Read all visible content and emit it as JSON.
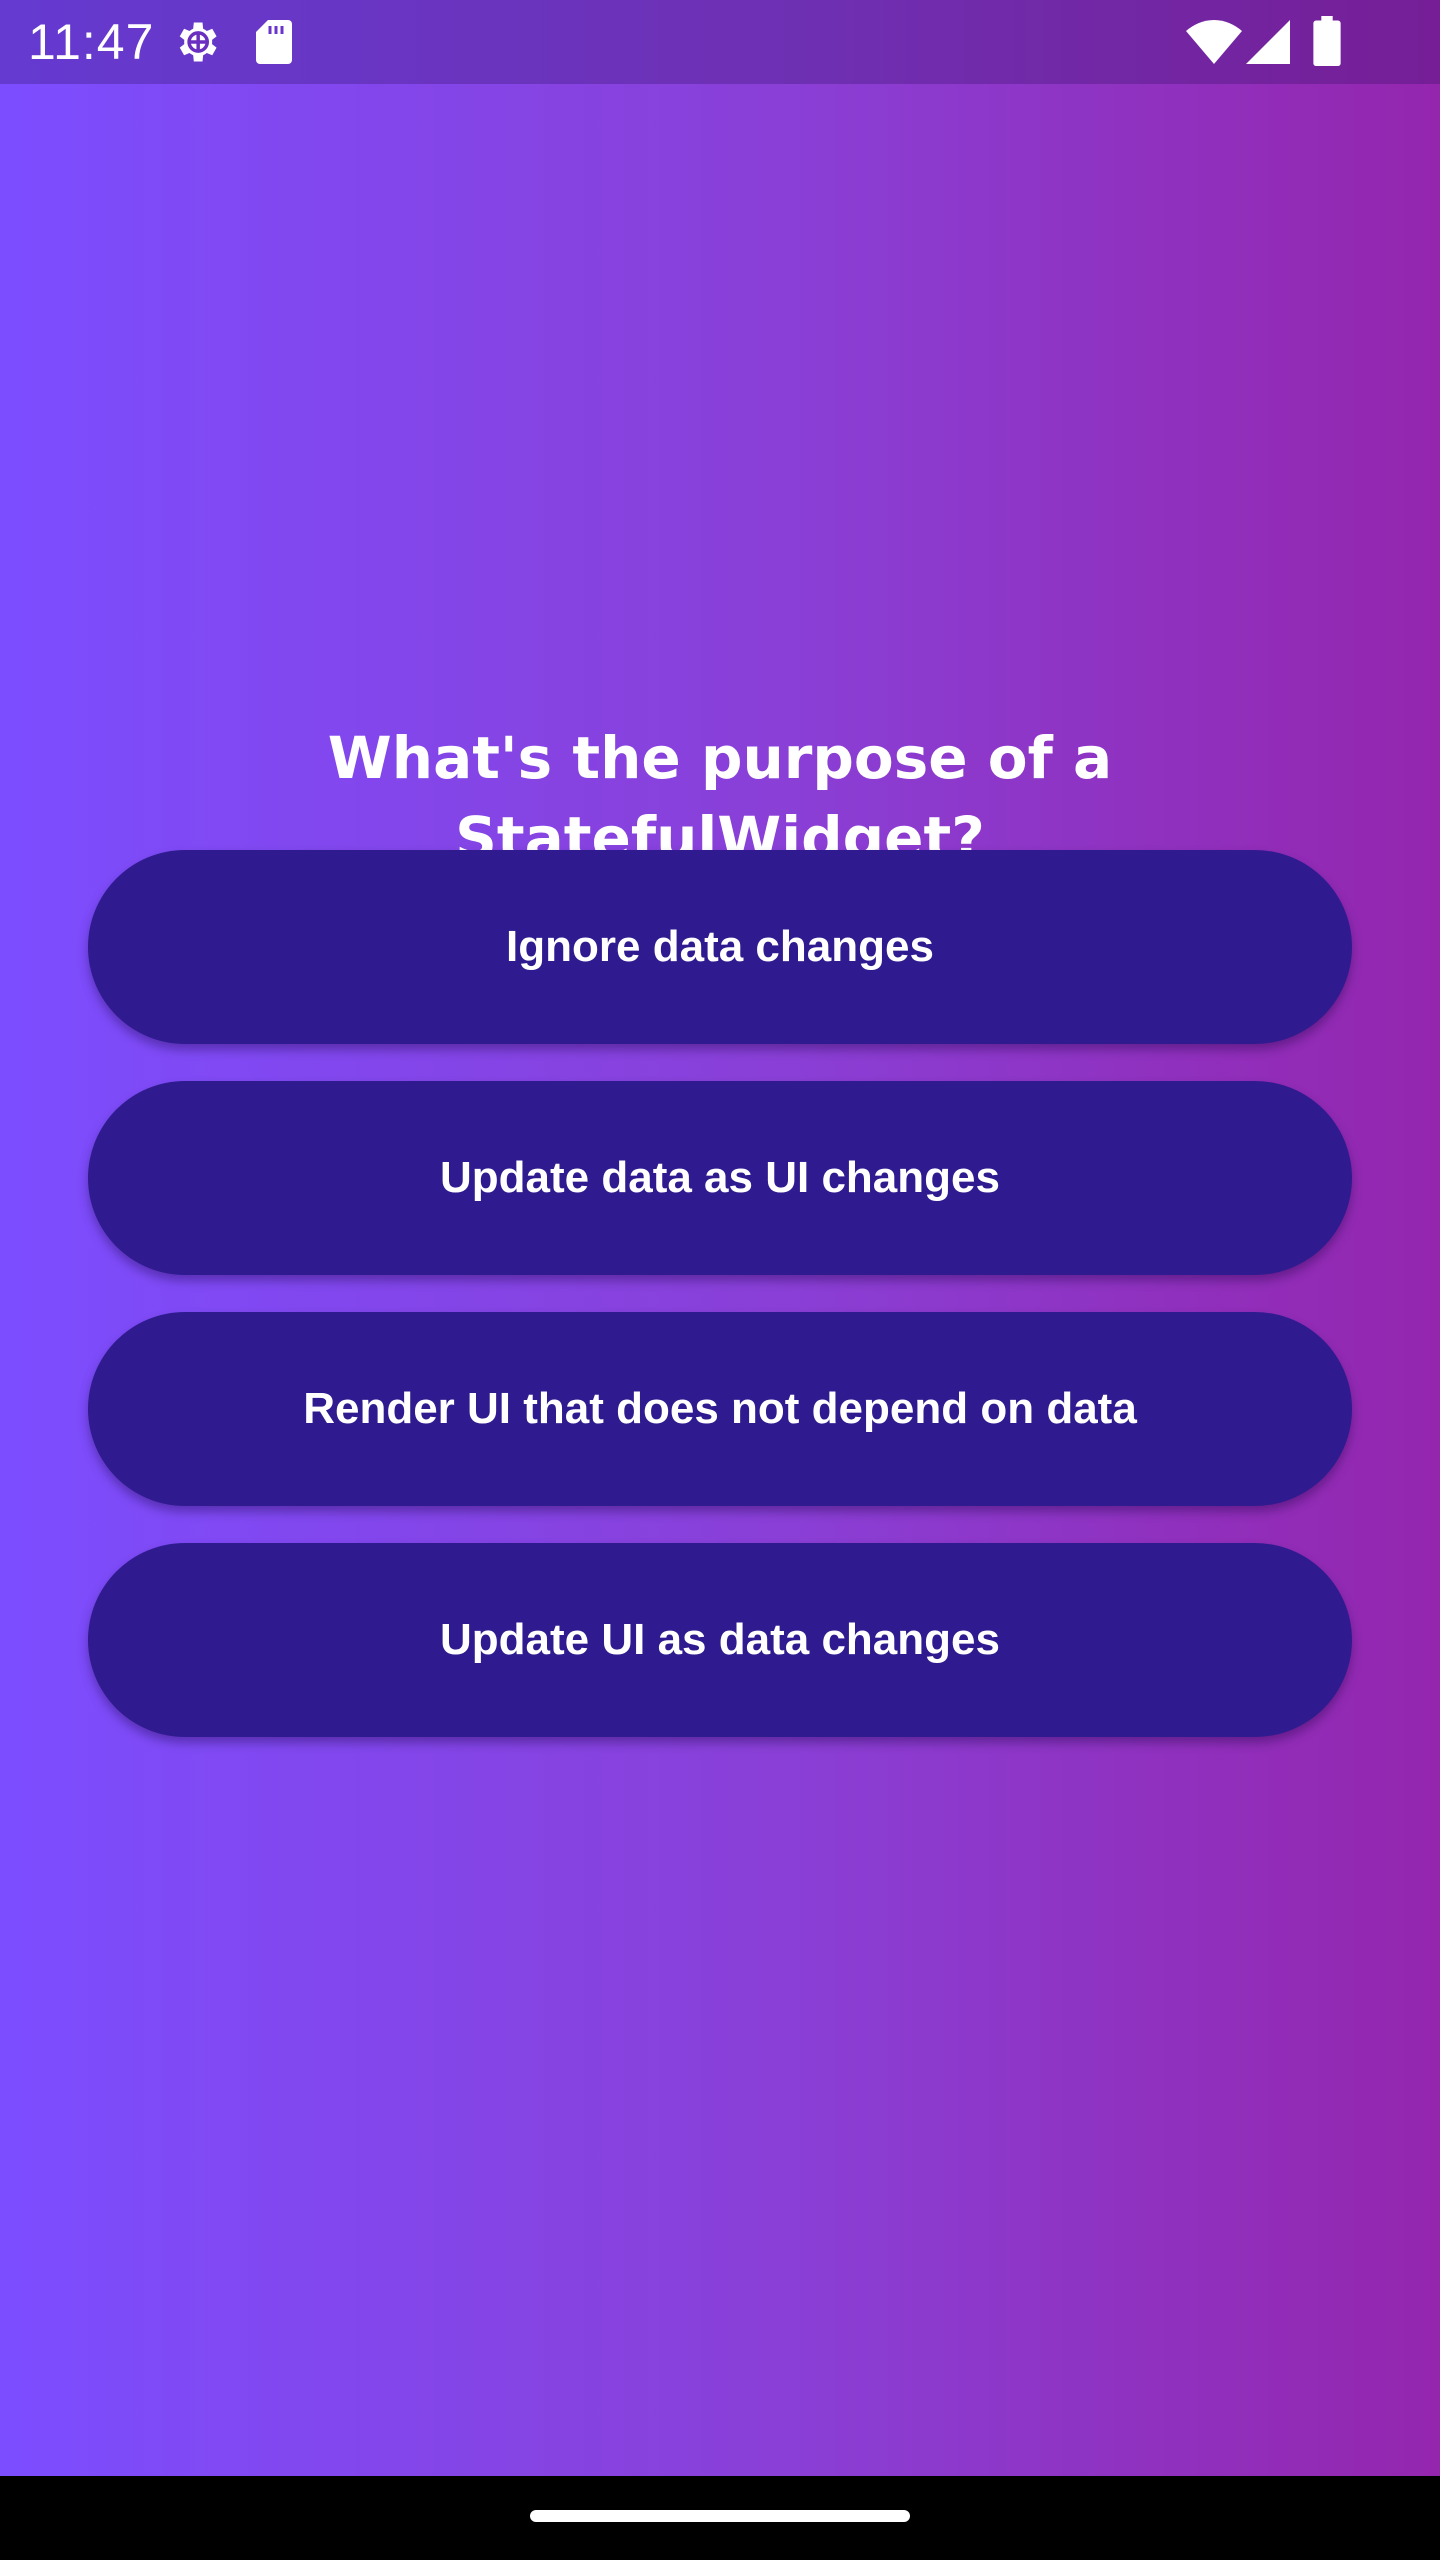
{
  "status_bar": {
    "time": "11:47",
    "icons": [
      "gear-icon",
      "sd-card-icon",
      "wifi-icon",
      "signal-icon",
      "battery-icon"
    ]
  },
  "quiz": {
    "question": "What's the purpose of a StatefulWidget?",
    "answers": [
      "Ignore data changes",
      "Update data as UI changes",
      "Render UI that does not depend on data",
      "Update UI as data changes"
    ]
  },
  "colors": {
    "gradient_start": "#7c4dff",
    "gradient_end": "#9426ae",
    "button_background": "#2f1b8f",
    "text": "#ffffff"
  }
}
